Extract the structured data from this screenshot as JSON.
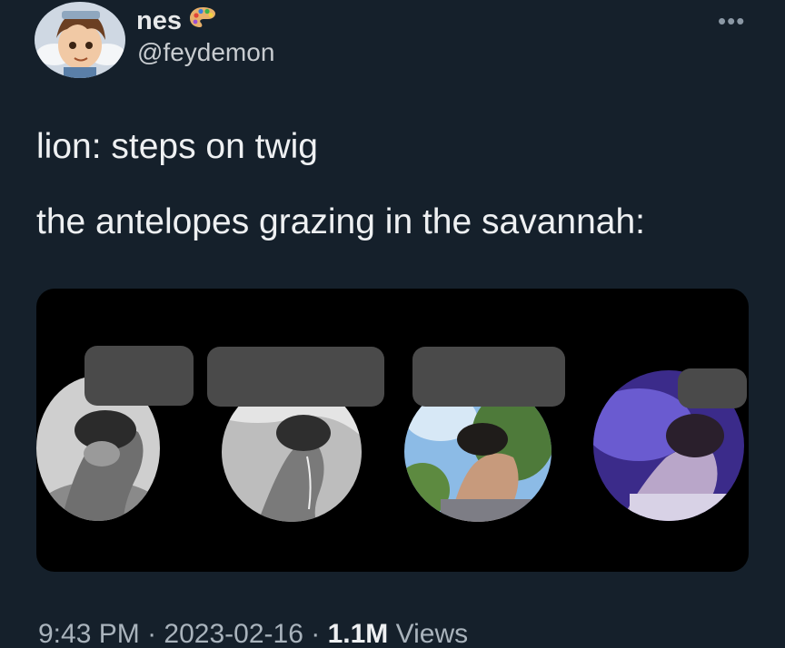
{
  "tweet": {
    "display_name": "nes",
    "handle": "@feydemon",
    "more_icon": "ellipsis-icon",
    "badge_icon": "palette-icon",
    "text_lines": [
      "lion: steps on twig",
      "the antelopes grazing in the savannah:"
    ],
    "time": "9:43 PM",
    "separator": "·",
    "date": "2023-02-16",
    "views_count": "1.1M",
    "views_label": "Views"
  },
  "colors": {
    "background": "#15202b",
    "media_background": "#000000",
    "redaction": "#4a4a4a"
  }
}
